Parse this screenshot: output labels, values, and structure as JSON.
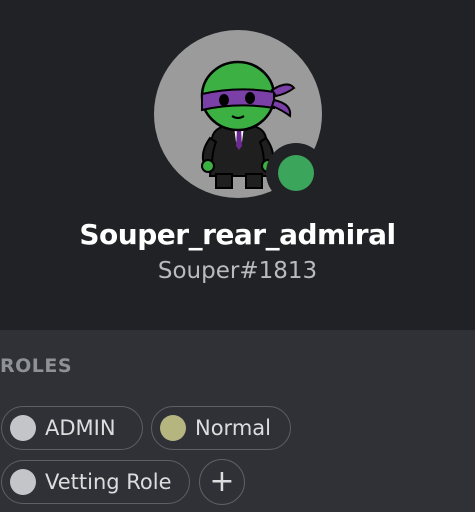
{
  "profile": {
    "username": "Souper_rear_admiral",
    "tag": "Souper#1813",
    "status": "online",
    "status_color": "#3ba55c",
    "avatar_icon": "ninja-turtle-avatar"
  },
  "roles": {
    "title": "ROLES",
    "items": [
      {
        "label": "ADMIN",
        "color": "#c4c5c8"
      },
      {
        "label": "Normal",
        "color": "#b5b580"
      },
      {
        "label": "Vetting Role",
        "color": "#c4c5c8"
      }
    ],
    "add_label": "+"
  }
}
